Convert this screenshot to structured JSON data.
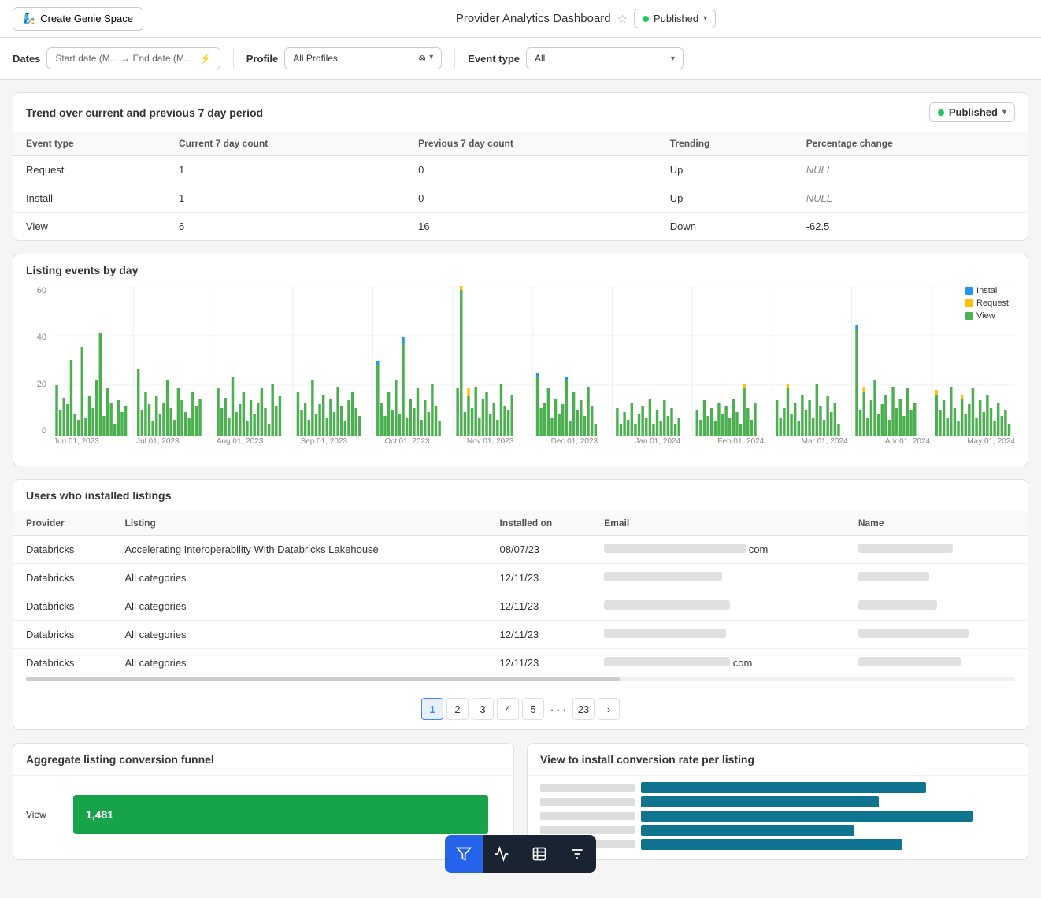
{
  "topbar": {
    "create_btn": "Create Genie Space",
    "title": "Provider Analytics Dashboard",
    "published_label": "Published"
  },
  "filters": {
    "dates_label": "Dates",
    "dates_placeholder": "Start date (M... → End date (M...",
    "profile_label": "Profile",
    "profile_value": "All Profiles",
    "event_type_label": "Event type",
    "event_type_value": "All"
  },
  "trend_section": {
    "title": "Trend over current and previous 7 day period",
    "published_label": "Published",
    "columns": [
      "Event type",
      "Current 7 day count",
      "Previous 7 day count",
      "Trending",
      "Percentage change"
    ],
    "rows": [
      {
        "event_type": "Request",
        "current": "1",
        "previous": "0",
        "trending": "Up",
        "pct": "NULL"
      },
      {
        "event_type": "Install",
        "current": "1",
        "previous": "0",
        "trending": "Up",
        "pct": "NULL"
      },
      {
        "event_type": "View",
        "current": "6",
        "previous": "16",
        "trending": "Down",
        "pct": "-62.5"
      }
    ]
  },
  "chart_section": {
    "title": "Listing events by day",
    "y_labels": [
      "60",
      "40",
      "20",
      "0"
    ],
    "x_labels": [
      "Jun 01, 2023",
      "Jul 01, 2023",
      "Aug 01, 2023",
      "Sep 01, 2023",
      "Oct 01, 2023",
      "Nov 01, 2023",
      "Dec 01, 2023",
      "Jan 01, 2024",
      "Feb 01, 2024",
      "Mar 01, 2024",
      "Apr 01, 2024",
      "May 01, 2024"
    ],
    "legend": [
      {
        "label": "Install",
        "color": "#2196f3"
      },
      {
        "label": "Request",
        "color": "#ffc107"
      },
      {
        "label": "View",
        "color": "#4caf50"
      }
    ]
  },
  "users_section": {
    "title": "Users who installed listings",
    "columns": [
      "Provider",
      "Listing",
      "Installed on",
      "Email",
      "Name"
    ],
    "rows": [
      {
        "provider": "Databricks",
        "listing": "Accelerating Interoperability With Databricks Lakehouse",
        "installed_on": "08/07/23",
        "email_blur": "180px",
        "name_blur": "120px"
      },
      {
        "provider": "Databricks",
        "listing": "All categories",
        "installed_on": "12/11/23",
        "email_blur": "150px",
        "name_blur": "90px"
      },
      {
        "provider": "Databricks",
        "listing": "All categories",
        "installed_on": "12/11/23",
        "email_blur": "160px",
        "name_blur": "100px"
      },
      {
        "provider": "Databricks",
        "listing": "All categories",
        "installed_on": "12/11/23",
        "email_blur": "155px",
        "name_blur": "140px"
      },
      {
        "provider": "Databricks",
        "listing": "All categories",
        "installed_on": "12/11/23",
        "email_blur": "160px",
        "name_blur": "130px"
      }
    ]
  },
  "pagination": {
    "pages": [
      "1",
      "2",
      "3",
      "4",
      "5",
      "...",
      "23"
    ],
    "active": "1"
  },
  "funnel_section": {
    "title": "Aggregate listing conversion funnel",
    "view_label": "View",
    "view_value": "1,481"
  },
  "conversion_section": {
    "title": "View to install conversion rate per listing"
  },
  "toolbar": {
    "buttons": [
      "filter",
      "chart-line",
      "table",
      "filter-2"
    ]
  }
}
